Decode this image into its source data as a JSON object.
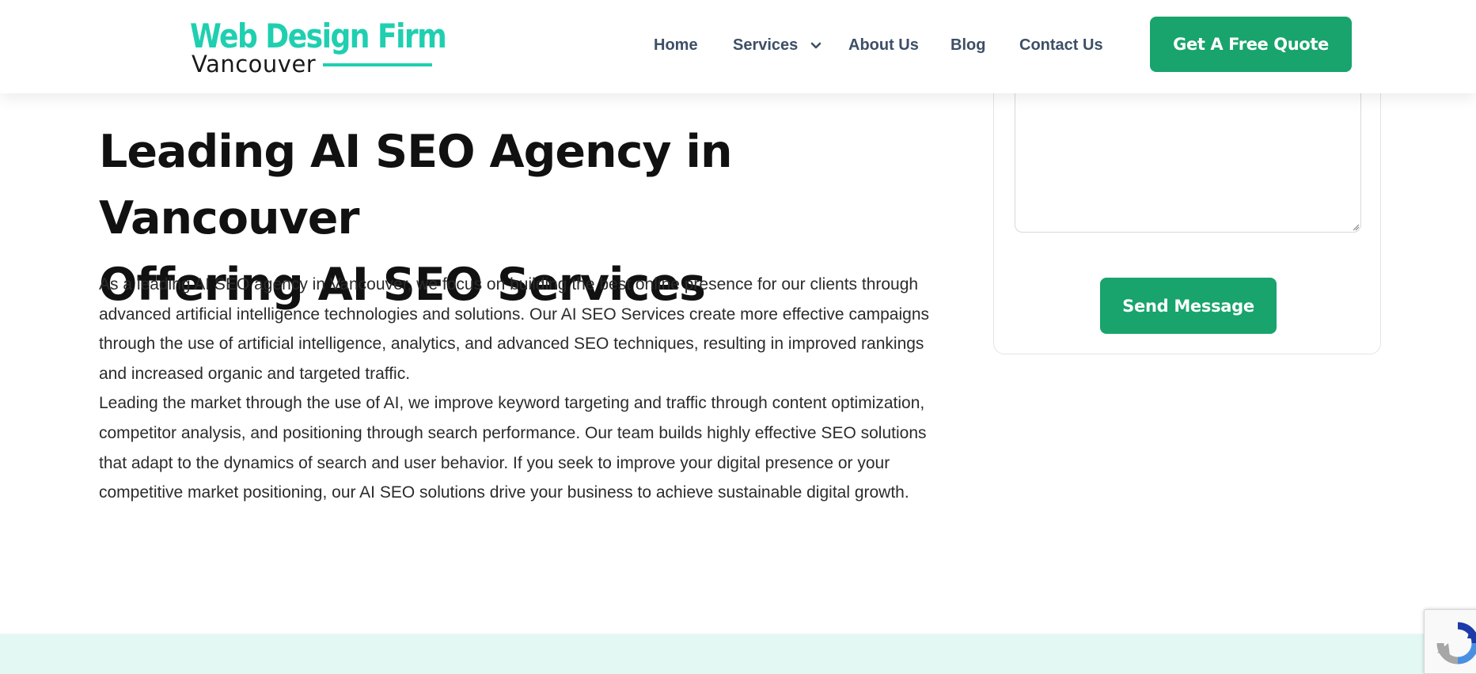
{
  "header": {
    "logo": {
      "line1": "Web Design Firm",
      "line2": "Vancouver"
    },
    "nav": {
      "home": "Home",
      "services": "Services",
      "about": "About Us",
      "blog": "Blog",
      "contact": "Contact Us"
    },
    "cta_label": "Get A Free Quote"
  },
  "hero": {
    "title_line1": "Leading AI SEO Agency in Vancouver",
    "title_line2": "Offering AI SEO Services",
    "paragraph1": "As a leading AI SEO agency in Vancouver, we focus on building the best online presence for our clients through advanced artificial intelligence technologies and solutions. Our AI SEO Services create more effective campaigns through the use of artificial intelligence, analytics, and advanced SEO techniques, resulting in improved rankings and increased organic and targeted traffic.",
    "paragraph2": "Leading the market through the use of AI, we improve keyword targeting and traffic through content optimization, competitor analysis, and positioning through search performance. Our team builds highly effective SEO solutions that adapt to the dynamics of search and user behavior. If you seek to improve your digital presence or your competitive market positioning, our AI SEO solutions drive your business to achieve sustainable digital growth."
  },
  "form": {
    "message_value": "",
    "send_label": "Send Message"
  },
  "colors": {
    "brand_teal": "#1fcfb0",
    "button_green": "#18a46c",
    "nav_text": "#3d4f66",
    "section_band": "#e4f8f3"
  },
  "icons": {
    "services_dropdown": "chevron-down-icon",
    "textarea_resize": "resize-grip-icon",
    "recaptcha": "recaptcha-icon"
  }
}
